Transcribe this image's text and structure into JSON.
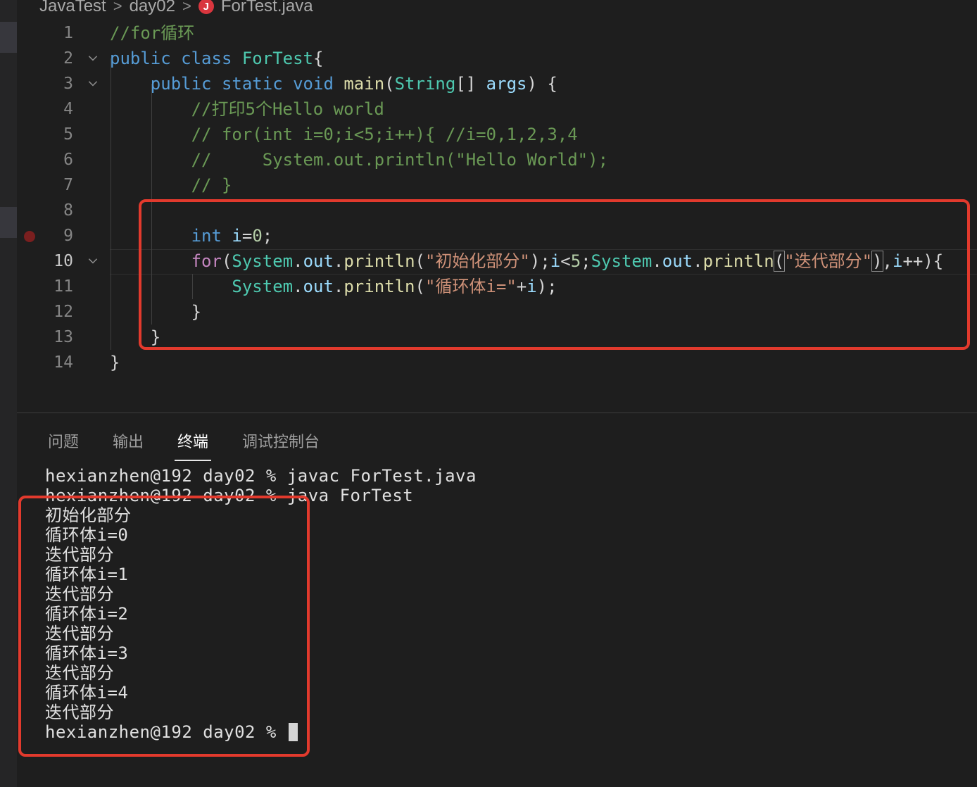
{
  "breadcrumb": {
    "project": "JavaTest",
    "folder": "day02",
    "file": "ForTest.java",
    "file_icon_letter": "J",
    "separator": ">"
  },
  "editor": {
    "lines": [
      {
        "n": "1",
        "fold": false,
        "tokens": [
          {
            "c": "c",
            "t": "//for循环"
          }
        ]
      },
      {
        "n": "2",
        "fold": true,
        "tokens": [
          {
            "c": "k",
            "t": "public"
          },
          {
            "c": "",
            "t": " "
          },
          {
            "c": "k",
            "t": "class"
          },
          {
            "c": "",
            "t": " "
          },
          {
            "c": "t",
            "t": "ForTest"
          },
          {
            "c": "",
            "t": "{"
          }
        ]
      },
      {
        "n": "3",
        "fold": true,
        "tokens": [
          {
            "c": "",
            "t": "    "
          },
          {
            "c": "k",
            "t": "public"
          },
          {
            "c": "",
            "t": " "
          },
          {
            "c": "k",
            "t": "static"
          },
          {
            "c": "",
            "t": " "
          },
          {
            "c": "k",
            "t": "void"
          },
          {
            "c": "",
            "t": " "
          },
          {
            "c": "f",
            "t": "main"
          },
          {
            "c": "",
            "t": "("
          },
          {
            "c": "t",
            "t": "String"
          },
          {
            "c": "",
            "t": "[] "
          },
          {
            "c": "v",
            "t": "args"
          },
          {
            "c": "",
            "t": ") {"
          }
        ]
      },
      {
        "n": "4",
        "fold": false,
        "tokens": [
          {
            "c": "",
            "t": "        "
          },
          {
            "c": "c",
            "t": "//打印5个Hello world"
          }
        ]
      },
      {
        "n": "5",
        "fold": false,
        "tokens": [
          {
            "c": "",
            "t": "        "
          },
          {
            "c": "c",
            "t": "// for(int i=0;i<5;i++){ //i=0,1,2,3,4"
          }
        ]
      },
      {
        "n": "6",
        "fold": false,
        "tokens": [
          {
            "c": "",
            "t": "        "
          },
          {
            "c": "c",
            "t": "//     System.out.println(\"Hello World\");"
          }
        ]
      },
      {
        "n": "7",
        "fold": false,
        "tokens": [
          {
            "c": "",
            "t": "        "
          },
          {
            "c": "c",
            "t": "// }"
          }
        ]
      },
      {
        "n": "8",
        "fold": false,
        "tokens": [
          {
            "c": "",
            "t": ""
          }
        ]
      },
      {
        "n": "9",
        "fold": false,
        "tokens": [
          {
            "c": "",
            "t": "        "
          },
          {
            "c": "k",
            "t": "int"
          },
          {
            "c": "",
            "t": " "
          },
          {
            "c": "v",
            "t": "i"
          },
          {
            "c": "",
            "t": "="
          },
          {
            "c": "n",
            "t": "0"
          },
          {
            "c": "",
            "t": ";"
          }
        ]
      },
      {
        "n": "10",
        "fold": true,
        "tokens": [
          {
            "c": "",
            "t": "        "
          },
          {
            "c": "kc",
            "t": "for"
          },
          {
            "c": "",
            "t": "("
          },
          {
            "c": "t",
            "t": "System"
          },
          {
            "c": "",
            "t": "."
          },
          {
            "c": "v",
            "t": "out"
          },
          {
            "c": "",
            "t": "."
          },
          {
            "c": "f",
            "t": "println"
          },
          {
            "c": "",
            "t": "("
          },
          {
            "c": "s",
            "t": "\"初始化部分\""
          },
          {
            "c": "",
            "t": ");"
          },
          {
            "c": "v",
            "t": "i"
          },
          {
            "c": "",
            "t": "<"
          },
          {
            "c": "n",
            "t": "5"
          },
          {
            "c": "",
            "t": ";"
          },
          {
            "c": "t",
            "t": "System"
          },
          {
            "c": "",
            "t": "."
          },
          {
            "c": "v",
            "t": "out"
          },
          {
            "c": "",
            "t": "."
          },
          {
            "c": "f",
            "t": "println"
          },
          {
            "c": "hl",
            "t": "("
          },
          {
            "c": "s",
            "t": "\"迭代部分\""
          },
          {
            "c": "hl",
            "t": ")"
          },
          {
            "c": "",
            "t": ","
          },
          {
            "c": "v",
            "t": "i"
          },
          {
            "c": "",
            "t": "++){"
          }
        ]
      },
      {
        "n": "11",
        "fold": false,
        "tokens": [
          {
            "c": "",
            "t": "            "
          },
          {
            "c": "t",
            "t": "System"
          },
          {
            "c": "",
            "t": "."
          },
          {
            "c": "v",
            "t": "out"
          },
          {
            "c": "",
            "t": "."
          },
          {
            "c": "f",
            "t": "println"
          },
          {
            "c": "",
            "t": "("
          },
          {
            "c": "s",
            "t": "\"循环体i=\""
          },
          {
            "c": "",
            "t": "+"
          },
          {
            "c": "v",
            "t": "i"
          },
          {
            "c": "",
            "t": ");"
          }
        ]
      },
      {
        "n": "12",
        "fold": false,
        "tokens": [
          {
            "c": "",
            "t": "        }"
          }
        ]
      },
      {
        "n": "13",
        "fold": false,
        "tokens": [
          {
            "c": "",
            "t": "    }"
          }
        ]
      },
      {
        "n": "14",
        "fold": false,
        "tokens": [
          {
            "c": "",
            "t": "}"
          }
        ]
      }
    ],
    "active_line": "10",
    "breakpoint_line": "9"
  },
  "panel": {
    "tabs": [
      "问题",
      "输出",
      "终端",
      "调试控制台"
    ],
    "active_tab": "终端"
  },
  "terminal": {
    "lines": [
      "hexianzhen@192 day02 % javac ForTest.java",
      "hexianzhen@192 day02 % java ForTest",
      "初始化部分",
      "循环体i=0",
      "迭代部分",
      "循环体i=1",
      "迭代部分",
      "循环体i=2",
      "迭代部分",
      "循环体i=3",
      "迭代部分",
      "循环体i=4",
      "迭代部分"
    ],
    "prompt": "hexianzhen@192 day02 % "
  },
  "colors": {
    "background": "#1e1e1e",
    "annotation_red": "#e23a2d",
    "keyword": "#569cd6",
    "control_keyword": "#c586c0",
    "type": "#4ec9b0",
    "variable": "#9cdcfe",
    "function": "#dcdcaa",
    "string": "#ce9178",
    "number": "#b5cea8",
    "comment": "#6a9955"
  }
}
